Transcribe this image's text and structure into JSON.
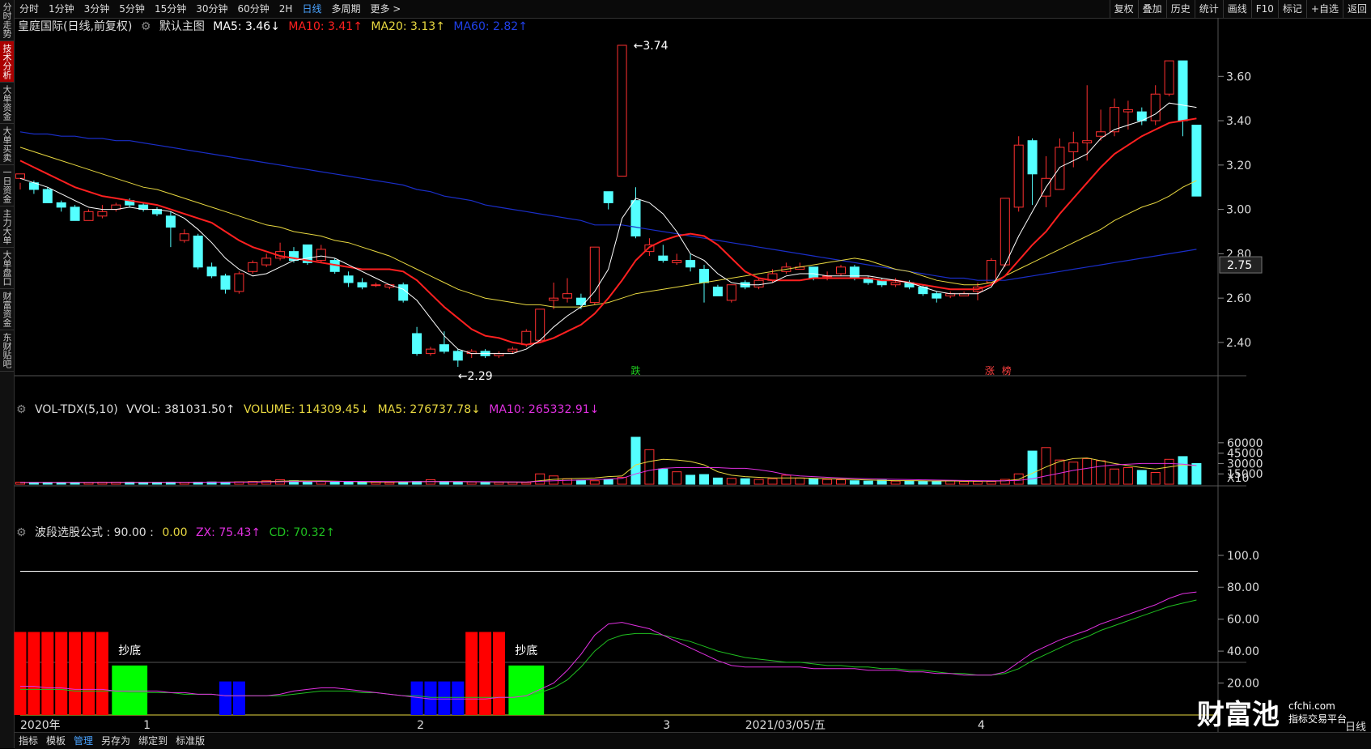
{
  "sidebar": [
    {
      "label": "分时走势",
      "active": false
    },
    {
      "label": "技术分析",
      "active": true
    },
    {
      "label": "大单资金",
      "active": false
    },
    {
      "label": "大单买卖",
      "active": false
    },
    {
      "label": "一日资金",
      "active": false
    },
    {
      "label": "主力大单",
      "active": false
    },
    {
      "label": "大单盘口",
      "active": false
    },
    {
      "label": "财富资金",
      "active": false
    },
    {
      "label": "东财贴吧",
      "active": false
    }
  ],
  "toolbar": {
    "periods": [
      "分时",
      "1分钟",
      "3分钟",
      "5分钟",
      "15分钟",
      "30分钟",
      "60分钟",
      "2H",
      "日线",
      "多周期",
      "更多 >"
    ],
    "active_period": "日线",
    "right_buttons": [
      "复权",
      "叠加",
      "历史",
      "统计",
      "画线",
      "F10",
      "标记",
      "+自选",
      "返回"
    ]
  },
  "main_header": {
    "title": "皇庭国际(日线,前复权)",
    "template": "默认主图",
    "ma5": "MA5: 3.46↓",
    "ma10": "MA10: 3.41↑",
    "ma20": "MA20: 3.13↑",
    "ma60": "MA60: 2.82↑"
  },
  "vol_header": {
    "name": "VOL-TDX(5,10)",
    "vvol": "VVOL: 381031.50↑",
    "volume": "VOLUME: 114309.45↓",
    "ma5": "MA5: 276737.78↓",
    "ma10": "MA10: 265332.91↓"
  },
  "ind_header": {
    "name": "波段选股公式 : 90.00 :",
    "v2": "0.00",
    "zx": "ZX: 75.43↑",
    "cd": "CD: 70.32↑"
  },
  "price_axis": [
    "3.60",
    "3.40",
    "3.20",
    "3.00",
    "2.80",
    "2.60",
    "2.40"
  ],
  "current_price": "2.75",
  "annotations": {
    "high": "3.74",
    "low": "2.29",
    "tag_die": "跌",
    "tag_zhang": "涨",
    "tag_bang": "榜",
    "chaodi": "抄底"
  },
  "vol_axis": [
    "60000",
    "45000",
    "30000",
    "15000",
    "X10"
  ],
  "ind_axis": [
    "100.0",
    "80.00",
    "60.00",
    "40.00",
    "20.00"
  ],
  "x_labels": [
    "2020年",
    "1",
    "2",
    "3",
    "2021/03/05/五",
    "4"
  ],
  "bottom_tabs": [
    "指标",
    "模板",
    "管理",
    "另存为",
    "绑定到",
    "标准版"
  ],
  "bottom_active": "管理",
  "watermark": {
    "brand": "财富池",
    "site": "cfchi.com",
    "slogan": "指标交易平台"
  },
  "corner_label": "日线",
  "colors": {
    "up": "#ff3030",
    "down": "#54ffff",
    "ma5": "#ffffff",
    "ma10": "#ff2020",
    "ma20": "#e8d840",
    "ma60": "#1a2ec8",
    "zx": "#e030e0",
    "cd": "#20c020"
  },
  "chart_data": {
    "type": "candlestick",
    "y_range": [
      2.25,
      3.78
    ],
    "candles": [
      [
        3.14,
        3.16,
        3.12,
        3.09
      ],
      [
        3.12,
        3.09,
        3.13,
        3.07
      ],
      [
        3.09,
        3.03,
        3.1,
        3.03
      ],
      [
        3.03,
        3.01,
        3.04,
        2.99
      ],
      [
        3.01,
        2.95,
        3.02,
        2.95
      ],
      [
        2.95,
        2.99,
        3.0,
        2.95
      ],
      [
        2.97,
        2.99,
        3.02,
        2.96
      ],
      [
        3.0,
        3.02,
        3.03,
        2.99
      ],
      [
        3.04,
        3.02,
        3.05,
        3.01
      ],
      [
        3.02,
        3.0,
        3.03,
        2.99
      ],
      [
        3.0,
        2.98,
        3.01,
        2.97
      ],
      [
        2.97,
        2.92,
        2.99,
        2.83
      ],
      [
        2.86,
        2.89,
        2.91,
        2.85
      ],
      [
        2.88,
        2.74,
        2.89,
        2.73
      ],
      [
        2.74,
        2.7,
        2.76,
        2.69
      ],
      [
        2.7,
        2.64,
        2.71,
        2.62
      ],
      [
        2.63,
        2.71,
        2.72,
        2.62
      ],
      [
        2.72,
        2.76,
        2.77,
        2.71
      ],
      [
        2.75,
        2.78,
        2.8,
        2.74
      ],
      [
        2.78,
        2.81,
        2.85,
        2.77
      ],
      [
        2.81,
        2.77,
        2.83,
        2.76
      ],
      [
        2.84,
        2.76,
        2.84,
        2.75
      ],
      [
        2.77,
        2.82,
        2.84,
        2.76
      ],
      [
        2.77,
        2.72,
        2.78,
        2.71
      ],
      [
        2.7,
        2.67,
        2.72,
        2.65
      ],
      [
        2.67,
        2.65,
        2.69,
        2.64
      ],
      [
        2.66,
        2.66,
        2.67,
        2.65
      ],
      [
        2.65,
        2.66,
        2.66,
        2.64
      ],
      [
        2.66,
        2.59,
        2.67,
        2.58
      ],
      [
        2.44,
        2.35,
        2.47,
        2.34
      ],
      [
        2.35,
        2.37,
        2.38,
        2.34
      ],
      [
        2.39,
        2.36,
        2.45,
        2.35
      ],
      [
        2.36,
        2.32,
        2.37,
        2.29
      ],
      [
        2.35,
        2.36,
        2.37,
        2.33
      ],
      [
        2.36,
        2.34,
        2.37,
        2.33
      ],
      [
        2.34,
        2.35,
        2.36,
        2.33
      ],
      [
        2.36,
        2.37,
        2.38,
        2.35
      ],
      [
        2.39,
        2.45,
        2.46,
        2.38
      ],
      [
        2.41,
        2.55,
        2.55,
        2.4
      ],
      [
        2.59,
        2.6,
        2.67,
        2.55
      ],
      [
        2.6,
        2.62,
        2.69,
        2.58
      ],
      [
        2.6,
        2.57,
        2.62,
        2.55
      ],
      [
        2.58,
        2.83,
        2.83,
        2.57
      ],
      [
        3.08,
        3.03,
        3.08,
        3.0
      ],
      [
        3.15,
        3.74,
        3.74,
        3.15
      ],
      [
        3.04,
        2.88,
        3.1,
        2.87
      ],
      [
        2.81,
        2.84,
        2.87,
        2.79
      ],
      [
        2.79,
        2.77,
        2.84,
        2.76
      ],
      [
        2.76,
        2.77,
        2.8,
        2.75
      ],
      [
        2.77,
        2.74,
        2.8,
        2.72
      ],
      [
        2.73,
        2.67,
        2.75,
        2.58
      ],
      [
        2.65,
        2.61,
        2.66,
        2.61
      ],
      [
        2.59,
        2.66,
        2.66,
        2.58
      ],
      [
        2.67,
        2.65,
        2.68,
        2.64
      ],
      [
        2.65,
        2.68,
        2.69,
        2.64
      ],
      [
        2.68,
        2.71,
        2.73,
        2.67
      ],
      [
        2.72,
        2.74,
        2.76,
        2.71
      ],
      [
        2.73,
        2.74,
        2.76,
        2.73
      ],
      [
        2.74,
        2.69,
        2.74,
        2.68
      ],
      [
        2.7,
        2.7,
        2.72,
        2.68
      ],
      [
        2.71,
        2.74,
        2.75,
        2.7
      ],
      [
        2.74,
        2.69,
        2.75,
        2.68
      ],
      [
        2.69,
        2.67,
        2.7,
        2.66
      ],
      [
        2.68,
        2.66,
        2.69,
        2.65
      ],
      [
        2.66,
        2.67,
        2.69,
        2.65
      ],
      [
        2.67,
        2.65,
        2.68,
        2.64
      ],
      [
        2.65,
        2.62,
        2.66,
        2.61
      ],
      [
        2.62,
        2.6,
        2.63,
        2.58
      ],
      [
        2.61,
        2.62,
        2.63,
        2.6
      ],
      [
        2.61,
        2.62,
        2.63,
        2.61
      ],
      [
        2.63,
        2.65,
        2.67,
        2.59
      ],
      [
        2.67,
        2.77,
        2.78,
        2.66
      ],
      [
        2.75,
        3.05,
        3.05,
        2.74
      ],
      [
        3.01,
        3.29,
        3.33,
        2.99
      ],
      [
        3.31,
        3.16,
        3.32,
        3.02
      ],
      [
        3.06,
        3.14,
        3.24,
        3.01
      ],
      [
        3.09,
        3.28,
        3.32,
        3.09
      ],
      [
        3.26,
        3.3,
        3.35,
        3.19
      ],
      [
        3.3,
        3.31,
        3.56,
        3.22
      ],
      [
        3.33,
        3.35,
        3.45,
        3.31
      ],
      [
        3.35,
        3.46,
        3.5,
        3.33
      ],
      [
        3.44,
        3.45,
        3.49,
        3.36
      ],
      [
        3.44,
        3.4,
        3.46,
        3.38
      ],
      [
        3.4,
        3.52,
        3.56,
        3.38
      ],
      [
        3.52,
        3.67,
        3.67,
        3.51
      ],
      [
        3.67,
        3.4,
        3.67,
        3.33
      ],
      [
        3.38,
        3.06,
        3.38,
        3.06
      ]
    ],
    "ma5": [
      3.14,
      3.12,
      3.1,
      3.07,
      3.04,
      3.01,
      3.0,
      3.0,
      3.01,
      3.0,
      3.0,
      2.99,
      2.96,
      2.91,
      2.85,
      2.78,
      2.73,
      2.7,
      2.71,
      2.74,
      2.77,
      2.78,
      2.79,
      2.78,
      2.75,
      2.72,
      2.69,
      2.66,
      2.64,
      2.59,
      2.51,
      2.43,
      2.37,
      2.35,
      2.35,
      2.35,
      2.35,
      2.37,
      2.41,
      2.47,
      2.52,
      2.56,
      2.63,
      2.73,
      2.96,
      3.05,
      3.03,
      2.98,
      2.9,
      2.8,
      2.77,
      2.71,
      2.67,
      2.66,
      2.66,
      2.67,
      2.7,
      2.71,
      2.71,
      2.7,
      2.7,
      2.7,
      2.7,
      2.69,
      2.68,
      2.67,
      2.65,
      2.63,
      2.62,
      2.62,
      2.62,
      2.65,
      2.75,
      2.88,
      2.99,
      3.1,
      3.19,
      3.22,
      3.25,
      3.32,
      3.36,
      3.38,
      3.4,
      3.43,
      3.48,
      3.47,
      3.46
    ],
    "ma10": [
      3.22,
      3.19,
      3.16,
      3.13,
      3.1,
      3.08,
      3.06,
      3.05,
      3.04,
      3.03,
      3.02,
      3.0,
      2.98,
      2.96,
      2.94,
      2.9,
      2.86,
      2.83,
      2.81,
      2.79,
      2.78,
      2.77,
      2.76,
      2.75,
      2.74,
      2.73,
      2.73,
      2.73,
      2.72,
      2.68,
      2.62,
      2.56,
      2.51,
      2.46,
      2.43,
      2.42,
      2.4,
      2.39,
      2.4,
      2.42,
      2.45,
      2.48,
      2.53,
      2.6,
      2.68,
      2.77,
      2.83,
      2.86,
      2.88,
      2.89,
      2.88,
      2.84,
      2.78,
      2.72,
      2.69,
      2.68,
      2.68,
      2.68,
      2.69,
      2.69,
      2.69,
      2.69,
      2.69,
      2.68,
      2.68,
      2.67,
      2.66,
      2.65,
      2.64,
      2.64,
      2.64,
      2.66,
      2.7,
      2.77,
      2.84,
      2.9,
      2.98,
      3.05,
      3.12,
      3.19,
      3.25,
      3.29,
      3.33,
      3.36,
      3.39,
      3.4,
      3.41
    ],
    "ma20": [
      3.28,
      3.26,
      3.24,
      3.22,
      3.2,
      3.18,
      3.16,
      3.14,
      3.12,
      3.1,
      3.09,
      3.07,
      3.05,
      3.03,
      3.01,
      2.99,
      2.97,
      2.95,
      2.93,
      2.92,
      2.9,
      2.89,
      2.88,
      2.86,
      2.85,
      2.83,
      2.81,
      2.79,
      2.76,
      2.73,
      2.7,
      2.67,
      2.64,
      2.62,
      2.6,
      2.59,
      2.58,
      2.57,
      2.57,
      2.56,
      2.56,
      2.56,
      2.57,
      2.58,
      2.6,
      2.62,
      2.63,
      2.64,
      2.65,
      2.66,
      2.67,
      2.68,
      2.69,
      2.7,
      2.71,
      2.72,
      2.73,
      2.74,
      2.75,
      2.76,
      2.77,
      2.78,
      2.77,
      2.75,
      2.73,
      2.72,
      2.7,
      2.68,
      2.67,
      2.66,
      2.66,
      2.67,
      2.7,
      2.73,
      2.76,
      2.79,
      2.82,
      2.85,
      2.88,
      2.91,
      2.95,
      2.98,
      3.01,
      3.03,
      3.06,
      3.1,
      3.13
    ],
    "ma60": [
      3.35,
      3.34,
      3.34,
      3.33,
      3.33,
      3.32,
      3.32,
      3.31,
      3.31,
      3.3,
      3.29,
      3.28,
      3.27,
      3.26,
      3.25,
      3.24,
      3.23,
      3.22,
      3.21,
      3.2,
      3.19,
      3.18,
      3.17,
      3.16,
      3.15,
      3.14,
      3.13,
      3.12,
      3.11,
      3.09,
      3.08,
      3.06,
      3.05,
      3.04,
      3.02,
      3.01,
      3.0,
      2.99,
      2.98,
      2.97,
      2.96,
      2.95,
      2.93,
      2.93,
      2.93,
      2.92,
      2.91,
      2.9,
      2.89,
      2.88,
      2.87,
      2.86,
      2.85,
      2.84,
      2.83,
      2.82,
      2.81,
      2.8,
      2.79,
      2.78,
      2.77,
      2.76,
      2.75,
      2.74,
      2.73,
      2.72,
      2.71,
      2.7,
      2.69,
      2.69,
      2.68,
      2.68,
      2.68,
      2.69,
      2.7,
      2.71,
      2.72,
      2.73,
      2.74,
      2.75,
      2.76,
      2.77,
      2.78,
      2.79,
      2.8,
      2.81,
      2.82
    ],
    "volume": {
      "y_range": [
        0,
        68000
      ],
      "values": [
        3000,
        2500,
        2500,
        2200,
        2500,
        2500,
        3000,
        3000,
        3000,
        2500,
        2800,
        3000,
        2800,
        3000,
        3200,
        3000,
        3500,
        4000,
        5000,
        6500,
        5000,
        3500,
        4000,
        3500,
        3500,
        3000,
        2800,
        2500,
        3000,
        4000,
        6500,
        4000,
        3500,
        3200,
        3000,
        2800,
        3000,
        2500,
        15000,
        12000,
        8000,
        6000,
        5000,
        7000,
        10000,
        68000,
        50000,
        22000,
        18000,
        13000,
        14000,
        9000,
        8500,
        8000,
        7000,
        8000,
        13000,
        9000,
        8000,
        7000,
        6500,
        5000,
        4500,
        6000,
        4500,
        5000,
        4000,
        4000,
        5000,
        4000,
        4000,
        4000,
        7000,
        15000,
        48000,
        53000,
        35000,
        32000,
        37000,
        34000,
        22000,
        24000,
        20000,
        17000,
        36000,
        40000,
        30000
      ],
      "ma5": [
        2500,
        2600,
        2600,
        2600,
        2700,
        2700,
        2700,
        2800,
        2800,
        2800,
        2800,
        2800,
        2800,
        2800,
        3000,
        3100,
        3200,
        3500,
        3900,
        4500,
        4800,
        4700,
        4700,
        4500,
        4000,
        3500,
        3300,
        3200,
        3300,
        3600,
        3900,
        3900,
        3900,
        3600,
        3400,
        3200,
        3000,
        2900,
        5200,
        7000,
        8000,
        8600,
        9000,
        11000,
        12000,
        28000,
        33000,
        36000,
        35000,
        33000,
        28000,
        18000,
        13000,
        11000,
        10000,
        9000,
        9000,
        9000,
        8600,
        8000,
        7500,
        6800,
        6200,
        5600,
        5200,
        5200,
        4900,
        4700,
        4800,
        4500,
        4500,
        4500,
        5000,
        7000,
        16000,
        25000,
        33000,
        37000,
        38000,
        34000,
        30000,
        27000,
        24000,
        22000,
        25000,
        28000,
        27000
      ],
      "ma10": [
        2600,
        2600,
        2600,
        2600,
        2600,
        2700,
        2700,
        2700,
        2700,
        2700,
        2700,
        2800,
        2800,
        2800,
        2900,
        2900,
        3000,
        3100,
        3300,
        3500,
        3700,
        3800,
        3900,
        4000,
        4100,
        4100,
        4000,
        3900,
        3900,
        3900,
        3800,
        3700,
        3700,
        3600,
        3600,
        3500,
        3400,
        3300,
        4200,
        5000,
        5500,
        6000,
        6600,
        7500,
        8500,
        15000,
        20000,
        23000,
        24000,
        24000,
        24000,
        24000,
        23000,
        23000,
        21000,
        18000,
        14000,
        12000,
        11000,
        10000,
        9000,
        8500,
        8000,
        7500,
        7000,
        6700,
        6300,
        6000,
        5700,
        5400,
        5200,
        5000,
        5000,
        5600,
        8000,
        12000,
        16000,
        20000,
        23000,
        26000,
        28000,
        29000,
        30000,
        30000,
        30000,
        29000,
        27000
      ]
    },
    "indicator": {
      "y_range": [
        0,
        108
      ],
      "line_value": 90,
      "zx": [
        18,
        18,
        17,
        17,
        16,
        16,
        16,
        15,
        15,
        15,
        15,
        14,
        14,
        13,
        13,
        12,
        12,
        12,
        12,
        13,
        15,
        16,
        17,
        17,
        16,
        15,
        14,
        13,
        12,
        11,
        10,
        10,
        10,
        10,
        10,
        11,
        11,
        12,
        16,
        20,
        28,
        38,
        50,
        57,
        58,
        56,
        54,
        50,
        46,
        42,
        38,
        34,
        31,
        30,
        30,
        30,
        30,
        30,
        29,
        29,
        29,
        29,
        28,
        28,
        28,
        27,
        27,
        26,
        26,
        25,
        25,
        25,
        27,
        33,
        39,
        43,
        47,
        50,
        53,
        57,
        60,
        63,
        66,
        69,
        73,
        76,
        77
      ],
      "cd": [
        16,
        16,
        16,
        16,
        15,
        15,
        15,
        15,
        14,
        14,
        14,
        14,
        13,
        13,
        13,
        12,
        12,
        12,
        12,
        12,
        13,
        14,
        15,
        15,
        15,
        14,
        14,
        13,
        12,
        12,
        11,
        11,
        11,
        11,
        11,
        11,
        11,
        12,
        14,
        17,
        22,
        30,
        40,
        47,
        50,
        51,
        51,
        50,
        48,
        46,
        43,
        40,
        38,
        36,
        35,
        34,
        33,
        33,
        32,
        31,
        31,
        30,
        30,
        29,
        29,
        28,
        28,
        27,
        26,
        26,
        25,
        25,
        26,
        29,
        34,
        38,
        42,
        46,
        49,
        53,
        56,
        59,
        62,
        65,
        68,
        70,
        72
      ],
      "red_bars_1": 7,
      "green_bar_1": 1,
      "blue_bars_1": 2,
      "blue_bars_2": 4,
      "red_bars_2": 3,
      "green_bar_2": 1
    }
  }
}
